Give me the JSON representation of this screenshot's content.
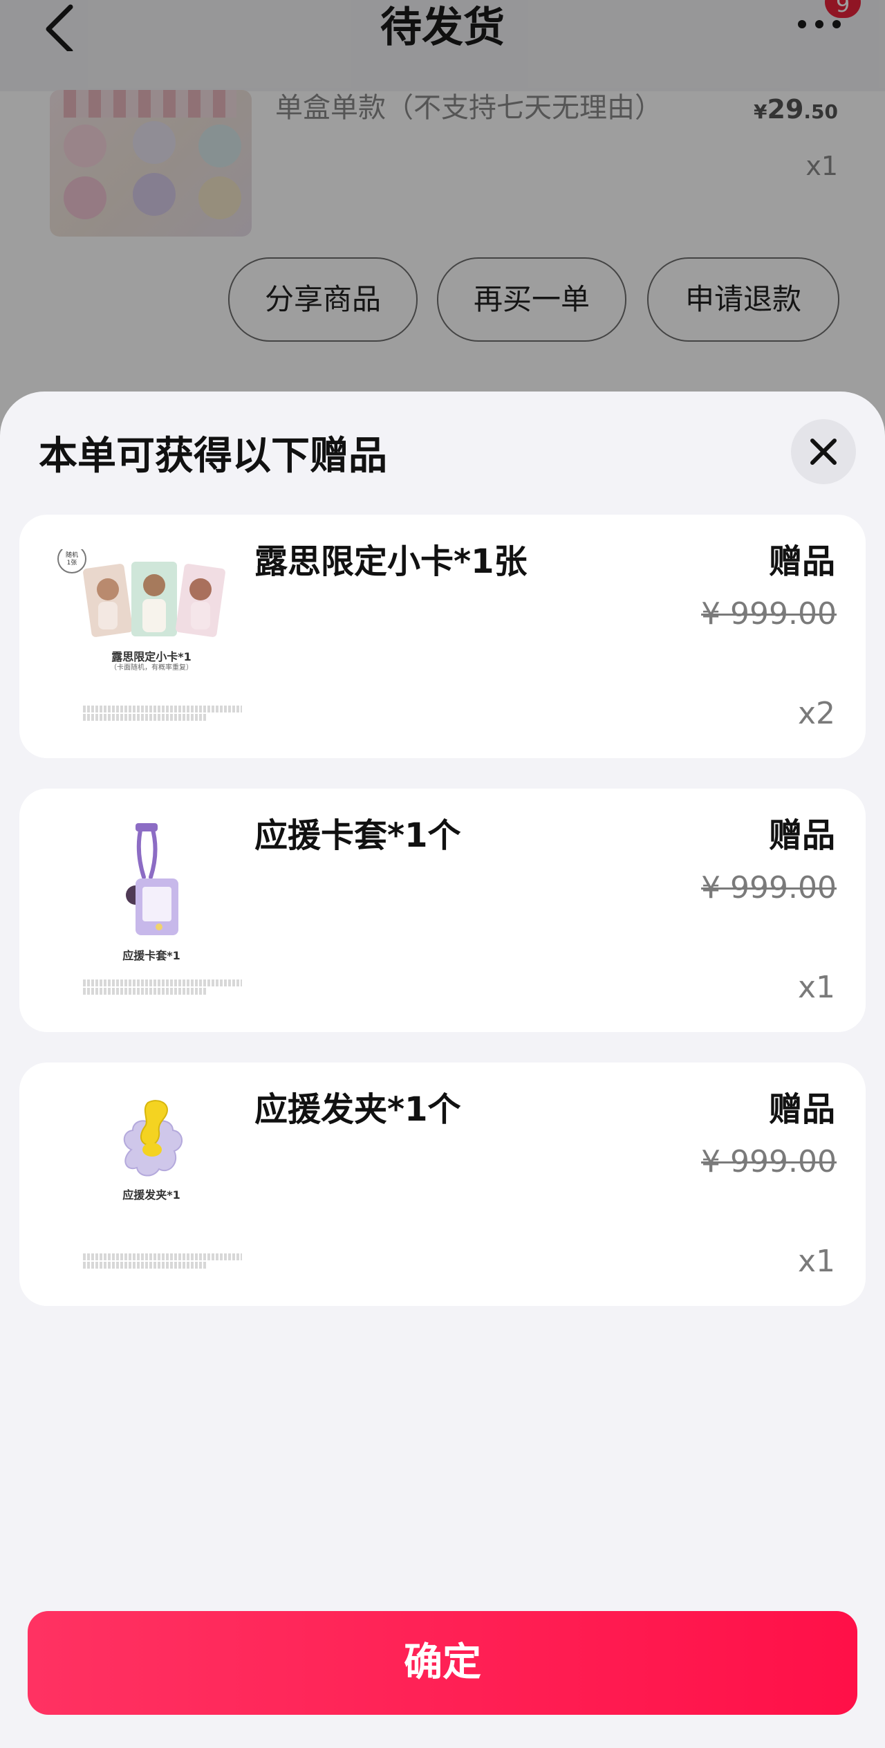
{
  "nav": {
    "title": "待发货",
    "badge_count": "9"
  },
  "order": {
    "product_spec": "单盒单款（不支持七天无理由）",
    "price_symbol": "¥",
    "price_int": "29",
    "price_dec": ".50",
    "quantity": "x1",
    "actions": [
      "分享商品",
      "再买一单",
      "申请退款"
    ]
  },
  "sheet": {
    "title": "本单可获得以下赠品",
    "gifts": [
      {
        "name": "露思限定小卡*1张",
        "tag": "赠品",
        "orig_price": "¥ 999.00",
        "qty": "x2",
        "image_caption": "露思限定小卡*1",
        "image_sub": "（卡面随机，有概率重复）",
        "image_badge": "随机\n1张"
      },
      {
        "name": "应援卡套*1个",
        "tag": "赠品",
        "orig_price": "¥ 999.00",
        "qty": "x1",
        "image_caption": "应援卡套*1"
      },
      {
        "name": "应援发夹*1个",
        "tag": "赠品",
        "orig_price": "¥ 999.00",
        "qty": "x1",
        "image_caption": "应援发夹*1"
      }
    ],
    "confirm_label": "确定"
  },
  "colors": {
    "accent": "#ff1f55",
    "badge": "#e8223b",
    "sheet_bg": "#f3f3f7"
  },
  "icons": [
    "back-arrow-icon",
    "more-dots-icon",
    "close-icon"
  ]
}
